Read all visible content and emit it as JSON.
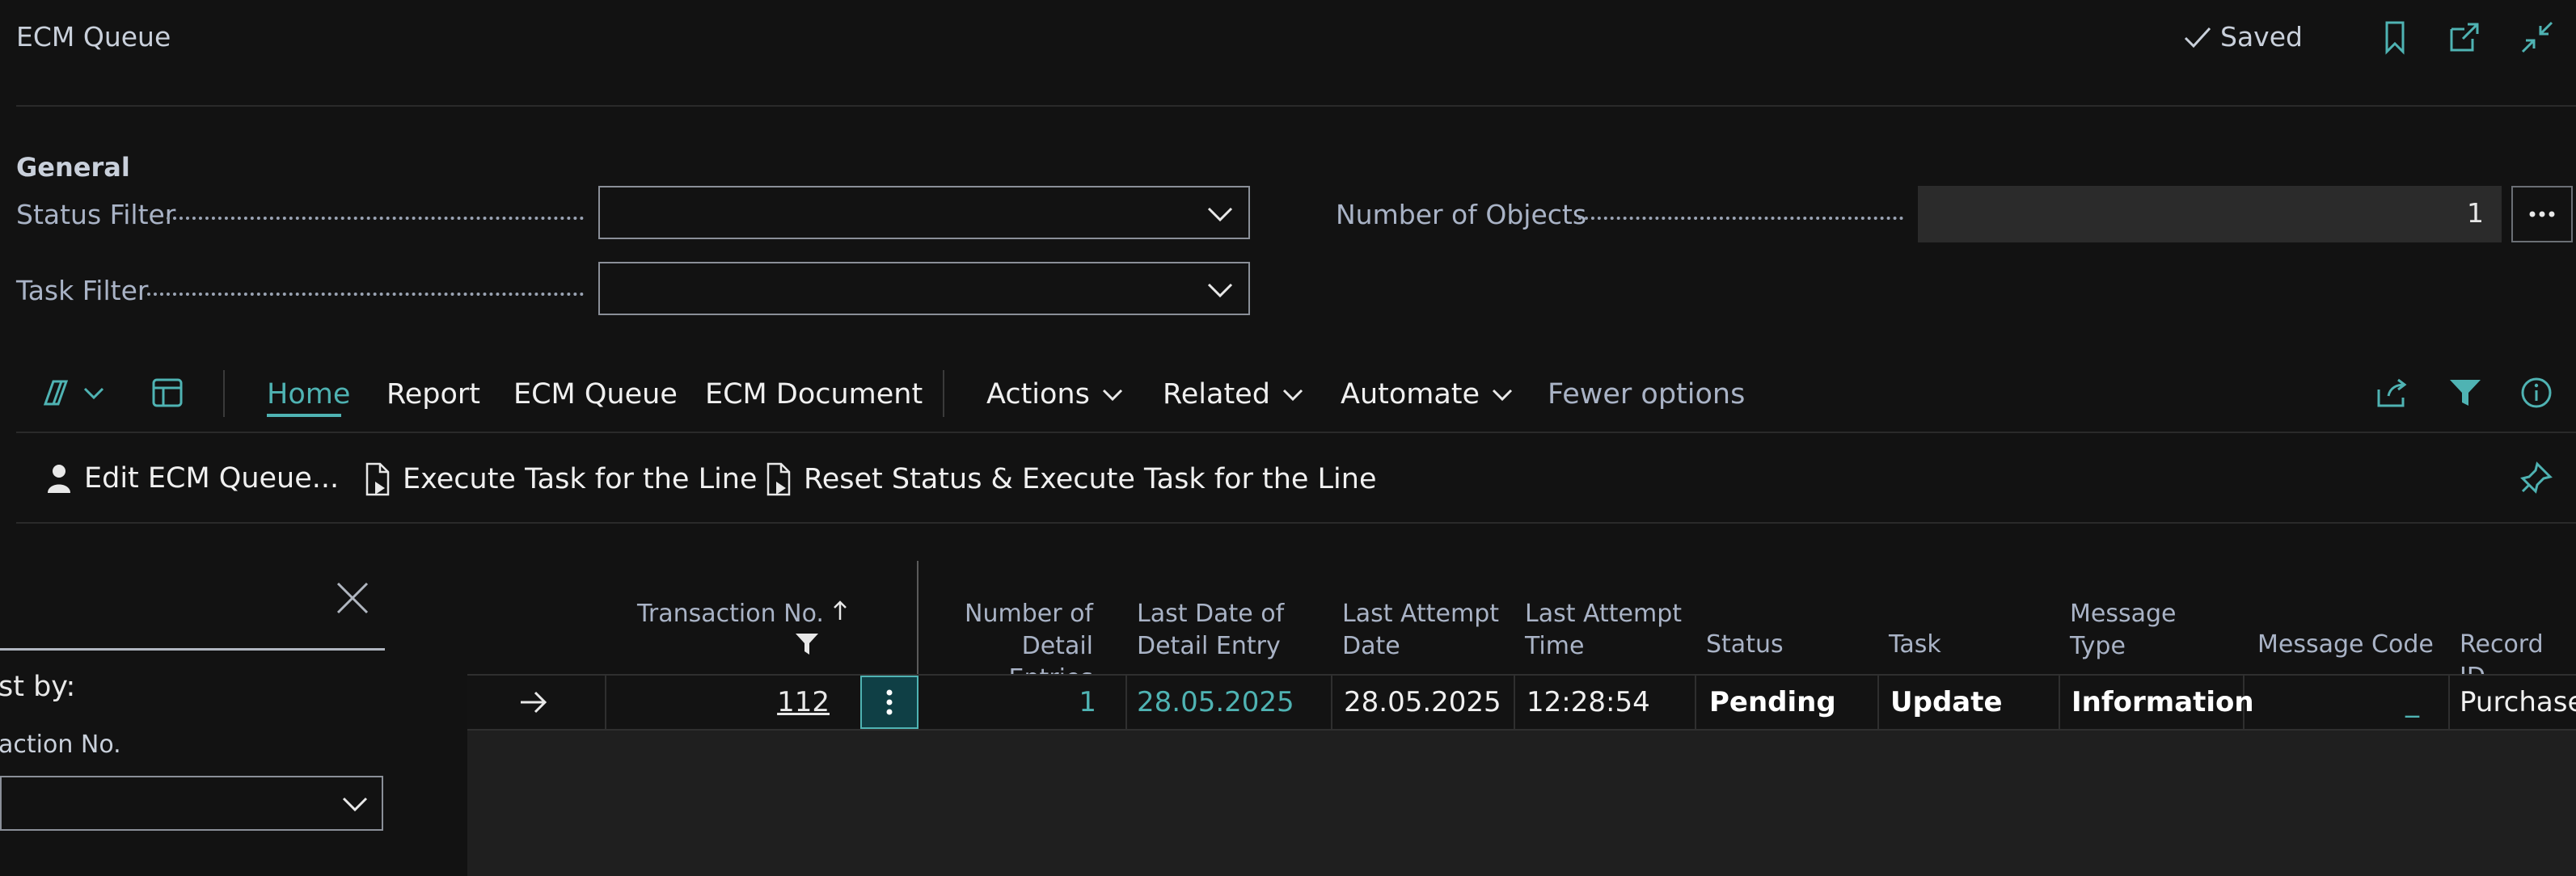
{
  "header": {
    "title": "ECM Queue",
    "saved_label": "Saved"
  },
  "general": {
    "section_title": "General",
    "status_filter_label": "Status Filter",
    "status_filter_value": "",
    "task_filter_label": "Task Filter",
    "task_filter_value": "",
    "number_of_objects_label": "Number of Objects",
    "number_of_objects_value": "1"
  },
  "menu": {
    "home": "Home",
    "report": "Report",
    "ecm_queue": "ECM Queue",
    "ecm_document": "ECM Document",
    "actions": "Actions",
    "related": "Related",
    "automate": "Automate",
    "fewer_options": "Fewer options"
  },
  "actions": {
    "edit": "Edit ECM Queue...",
    "execute": "Execute Task for the Line",
    "reset": "Reset Status & Execute Task for the Line"
  },
  "filter_pane": {
    "sort_label": "st by:",
    "field_label": "action No."
  },
  "grid": {
    "columns": {
      "transaction_no": "Transaction No.",
      "num_detail_1": "Number of",
      "num_detail_2": "Detail Entries",
      "last_date_1": "Last Date of",
      "last_date_2": "Detail Entry",
      "last_attempt_date_1": "Last Attempt",
      "last_attempt_date_2": "Date",
      "last_attempt_time_1": "Last Attempt",
      "last_attempt_time_2": "Time",
      "status": "Status",
      "task": "Task",
      "message_type_1": "Message",
      "message_type_2": "Type",
      "message_code": "Message Code",
      "record_id": "Record ID"
    },
    "rows": [
      {
        "transaction_no": "112",
        "number_of_detail_entries": "1",
        "last_date_of_detail_entry": "28.05.2025",
        "last_attempt_date": "28.05.2025",
        "last_attempt_time": "12:28:54",
        "status": "Pending",
        "task": "Update",
        "message_type": "Information",
        "message_code": "_",
        "record_id": "Purchase"
      }
    ]
  },
  "colors": {
    "accent": "#4fb3b3",
    "background": "#121212"
  }
}
